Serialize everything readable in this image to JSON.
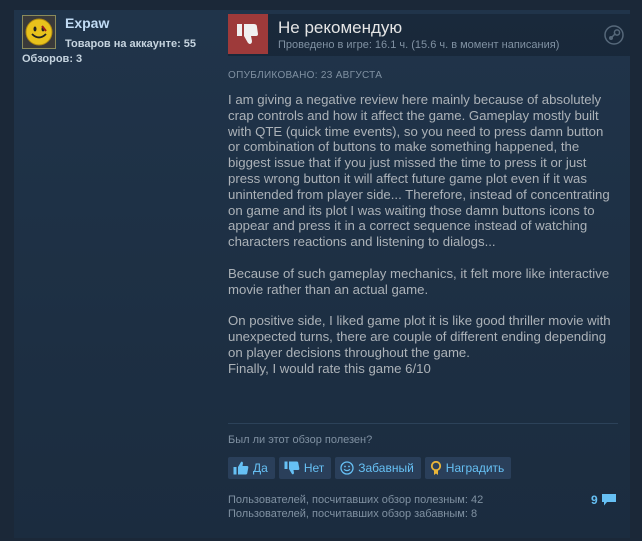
{
  "author": {
    "name": "Expaw",
    "products_label": "Товаров на аккаунте: 55",
    "reviews_label": "Обзоров: 3",
    "avatar_icon": "smiley-face-icon"
  },
  "review": {
    "verdict": "Не рекомендую",
    "verdict_icon": "thumbs-down-icon",
    "hours": "Проведено в игре: 16.1 ч. (15.6 ч. в момент написания)",
    "platform_icon": "steam-icon",
    "posted": "ОПУБЛИКОВАНО: 23 АВГУСТА",
    "paragraphs": [
      "I am giving a negative review here mainly because of absolutely crap controls and how it affect the game. Gameplay mostly built with QTE (quick time events), so you need to press damn button or combination of buttons to make something happened, the biggest issue that if you just missed the time to press it or just press wrong button it will affect future game plot even if it was unintended from player side... Therefore, instead of concentrating on game and its plot I was waiting those damn buttons icons to appear and press it in a correct sequence instead of watching characters reactions and listening to dialogs...",
      "Because of such gameplay mechanics, it felt more like interactive movie rather than an actual game.",
      "On positive side, I liked game plot it is like good thriller movie with unexpected turns, there are couple of different ending depending on player decisions throughout the game.",
      "Finally, I would rate this game 6/10"
    ]
  },
  "feedback": {
    "question": "Был ли этот обзор полезен?",
    "yes": "Да",
    "no": "Нет",
    "funny": "Забавный",
    "award": "Наградить"
  },
  "stats": {
    "helpful": "Пользователей, посчитавших обзор полезным: 42",
    "funny": "Пользователей, посчитавших обзор забавным: 8",
    "comments_count": "9"
  },
  "colors": {
    "background": "#1b2838",
    "accent": "#66c0f4",
    "negative": "#9e3a3a",
    "text": "#acb2b8"
  }
}
